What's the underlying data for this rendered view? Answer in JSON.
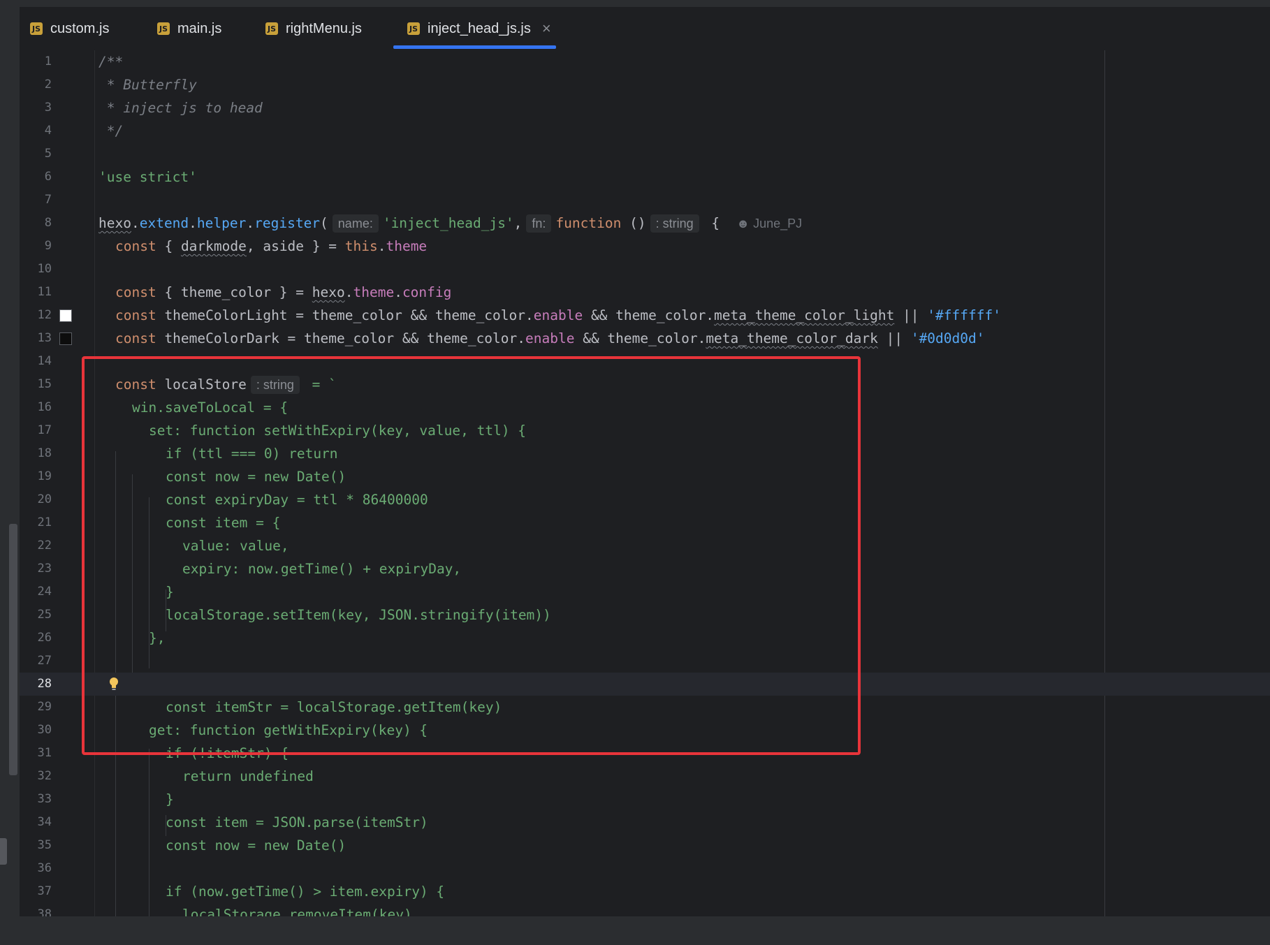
{
  "tabs": [
    {
      "label": "custom.js",
      "icon": "js-file-icon"
    },
    {
      "label": "main.js",
      "icon": "js-file-icon"
    },
    {
      "label": "rightMenu.js",
      "icon": "js-file-icon"
    },
    {
      "label": "inject_head_js.js",
      "icon": "js-file-icon",
      "active": true,
      "close": "×"
    }
  ],
  "tab_icon_text": "JS",
  "colors": {
    "accent": "#3574f0",
    "highlight_box": "#e8343a",
    "swatch_light": "#ffffff",
    "swatch_dark": "#0d0d0d"
  },
  "editor": {
    "current_line": 28,
    "lines": {
      "1": "1",
      "2": "2",
      "3": "3",
      "4": "4",
      "5": "5",
      "6": "6",
      "7": "7",
      "8": "8",
      "9": "9",
      "10": "10",
      "11": "11",
      "12": "12",
      "13": "13",
      "14": "14",
      "15": "15",
      "16": "16",
      "17": "17",
      "18": "18",
      "19": "19",
      "20": "20",
      "21": "21",
      "22": "22",
      "23": "23",
      "24": "24",
      "25": "25",
      "26": "26",
      "27": "27",
      "28": "28",
      "29": "29",
      "30": "30",
      "31": "31",
      "32": "32",
      "33": "33",
      "34": "34",
      "35": "35",
      "36": "36",
      "37": "37",
      "38": "38"
    },
    "code": {
      "l1": "/**",
      "l2": " * Butterfly",
      "l3": " * inject js to head",
      "l4": " */",
      "l6": "'use strict'",
      "l8": {
        "hexo": "hexo",
        "dot1": ".",
        "extend": "extend",
        "dot2": ".",
        "helper": "helper",
        "dot3": ".",
        "register": "register",
        "paren": "(",
        "hint_name": "name:",
        "arg1": "'inject_head_js'",
        "comma": ",",
        "hint_fn": "fn:",
        "function": "function",
        "parens": " ()",
        "hint_type": ": string",
        "brace": " {",
        "author": "June_PJ"
      },
      "l9": {
        "const": "const",
        "a": " { ",
        "darkmode": "darkmode",
        "b": ", aside } = ",
        "this": "this",
        "dot": ".",
        "theme": "theme"
      },
      "l11": {
        "const": "const",
        "a": " { theme_color } = ",
        "hexo": "hexo",
        "dot": ".",
        "theme": "theme",
        "dot2": ".",
        "config": "config"
      },
      "l12": {
        "const": "const",
        "a": " themeColorLight = theme_color && theme_color.",
        "enable": "enable",
        "b": " && theme_color.",
        "meta": "meta_theme_color_light",
        "c": " || ",
        "val": "'#ffffff'"
      },
      "l13": {
        "const": "const",
        "a": " themeColorDark = theme_color && theme_color.",
        "enable": "enable",
        "b": " && theme_color.",
        "meta": "meta_theme_color_dark",
        "c": " || ",
        "val": "'#0d0d0d'"
      },
      "l15": {
        "const": "const",
        "a": " localStore",
        "hint": ": string",
        "b": " = `"
      },
      "l16": "win.saveToLocal = {",
      "l17": "set: function setWithExpiry(key, value, ttl) {",
      "l18": "if (ttl === 0) return",
      "l19": "const now = new Date()",
      "l20": "const expiryDay = ttl * 86400000",
      "l21": "const item = {",
      "l22": "value: value,",
      "l23": "expiry: now.getTime() + expiryDay,",
      "l24": "}",
      "l25": "localStorage.setItem(key, JSON.stringify(item))",
      "l26": "},",
      "l28": "get: function getWithExpiry(key) {",
      "l29": "const itemStr = localStorage.getItem(key)",
      "l31": "if (!itemStr) {",
      "l32": "return undefined",
      "l33": "}",
      "l34": "const item = JSON.parse(itemStr)",
      "l35": "const now = new Date()",
      "l37": "if (now.getTime() > item.expiry) {",
      "l38": "localStorage.removeItem(key)"
    }
  }
}
